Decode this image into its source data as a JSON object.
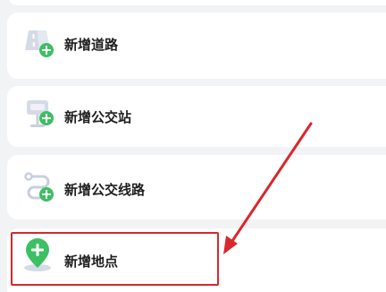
{
  "menu": {
    "items": [
      {
        "label": "新增道路",
        "icon": "road-add-icon"
      },
      {
        "label": "新增公交站",
        "icon": "bus-stop-add-icon"
      },
      {
        "label": "新增公交线路",
        "icon": "bus-route-add-icon"
      },
      {
        "label": "新增地点",
        "icon": "location-add-icon"
      }
    ]
  },
  "annotation": {
    "highlight_color": "#d8282e",
    "target": "新增地点"
  },
  "colors": {
    "accent_green": "#3dbf63",
    "icon_gray": "#c9d0dc",
    "background": "#f2f3f5"
  }
}
